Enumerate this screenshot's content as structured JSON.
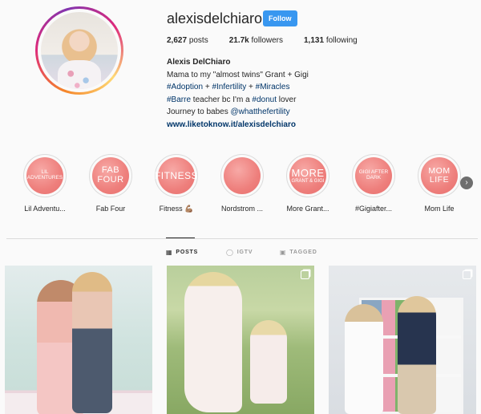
{
  "profile": {
    "username": "alexisdelchiaro",
    "follow_label": "Follow",
    "stats": {
      "posts_count": "2,627",
      "posts_label": "posts",
      "followers_count": "21.7k",
      "followers_label": "followers",
      "following_count": "1,131",
      "following_label": "following"
    },
    "bio": {
      "full_name": "Alexis DelChiaro",
      "line1": "Mama to my \"almost twins\" Grant + Gigi",
      "line2_tag1": "#Adoption",
      "line2_sep1": " + ",
      "line2_tag2": "#Infertility",
      "line2_sep2": " + ",
      "line2_tag3": "#Miracles",
      "line3_tag1": "#Barre",
      "line3_text1": " teacher bc I'm a ",
      "line3_tag2": "#donut",
      "line3_text2": " lover",
      "line4_text": "Journey to babes ",
      "line4_mention": "@whatthefertility",
      "website": "www.liketoknow.it/alexisdelchiaro"
    }
  },
  "highlights": [
    {
      "cover_text": "LIL ADVENTURES",
      "label": "Lil Adventu..."
    },
    {
      "cover_text": "FAB FOUR",
      "label": "Fab Four"
    },
    {
      "cover_text": "FITNESS",
      "label": "Fitness 💪🏽"
    },
    {
      "cover_text": "",
      "label": "Nordstrom ..."
    },
    {
      "cover_text": "MORE",
      "cover_subtext": "GRANT & GIGI",
      "label": "More Grant..."
    },
    {
      "cover_text": "GIGI AFTER DARK",
      "label": "#Gigiafter..."
    },
    {
      "cover_text": "MOM LIFE",
      "label": "Mom Life"
    }
  ],
  "tabs": [
    {
      "label": "POSTS",
      "icon": "grid-icon",
      "active": true
    },
    {
      "label": "IGTV",
      "icon": "igtv-icon",
      "active": false
    },
    {
      "label": "TAGGED",
      "icon": "tagged-icon",
      "active": false
    }
  ],
  "colors": {
    "accent": "#3897f0",
    "link": "#003569",
    "highlight_fill": "#ee7f7c"
  }
}
